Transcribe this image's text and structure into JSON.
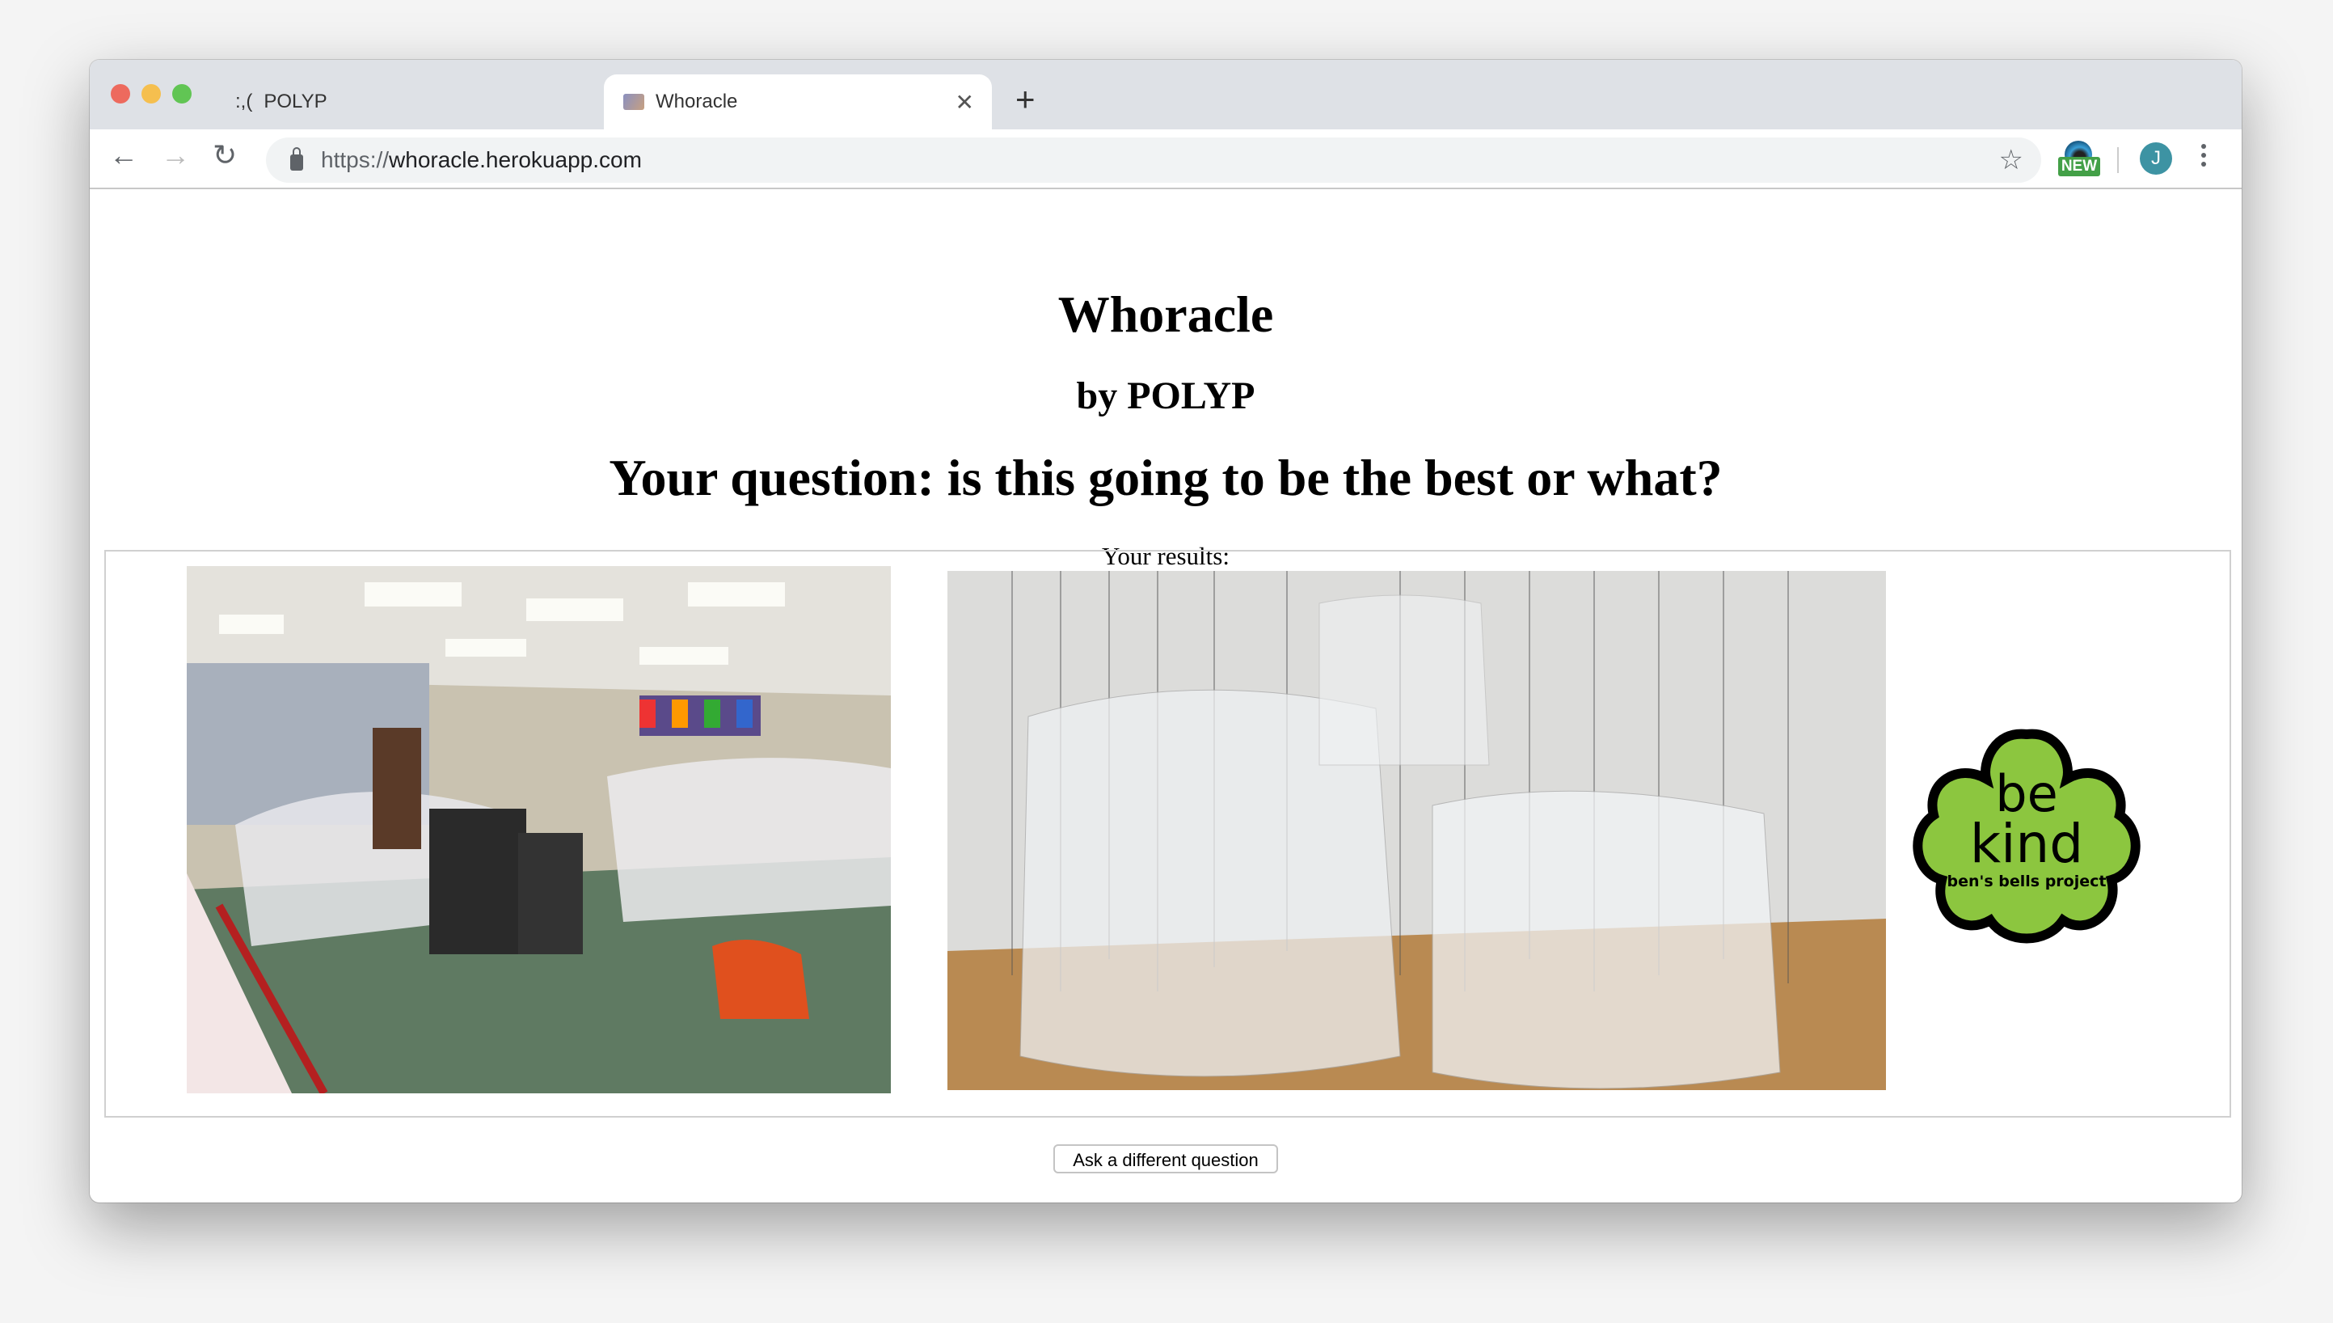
{
  "browser": {
    "tabs": [
      {
        "favicon": ":,(",
        "title": "POLYP",
        "active": false
      },
      {
        "favicon": "whoracle-favicon",
        "title": "Whoracle",
        "active": true
      }
    ],
    "url_scheme": "https://",
    "url_host": "whoracle.herokuapp.com",
    "extension_badge": "NEW",
    "profile_initial": "J"
  },
  "page": {
    "title": "Whoracle",
    "byline": "by POLYP",
    "question": "Your question: is this going to be the best or what?",
    "results_label": "Your results:",
    "results": [
      {
        "description": "classroom covered in plastic sheets"
      },
      {
        "description": "clear plastic jellyfish sculptures"
      },
      {
        "logo_text": [
          "be",
          "kind",
          "ben's bells project"
        ]
      }
    ],
    "ask_button": "Ask a different question"
  },
  "colors": {
    "logo_green": "#8cc63f",
    "avatar": "#3d93a3",
    "badge": "#43a047"
  }
}
